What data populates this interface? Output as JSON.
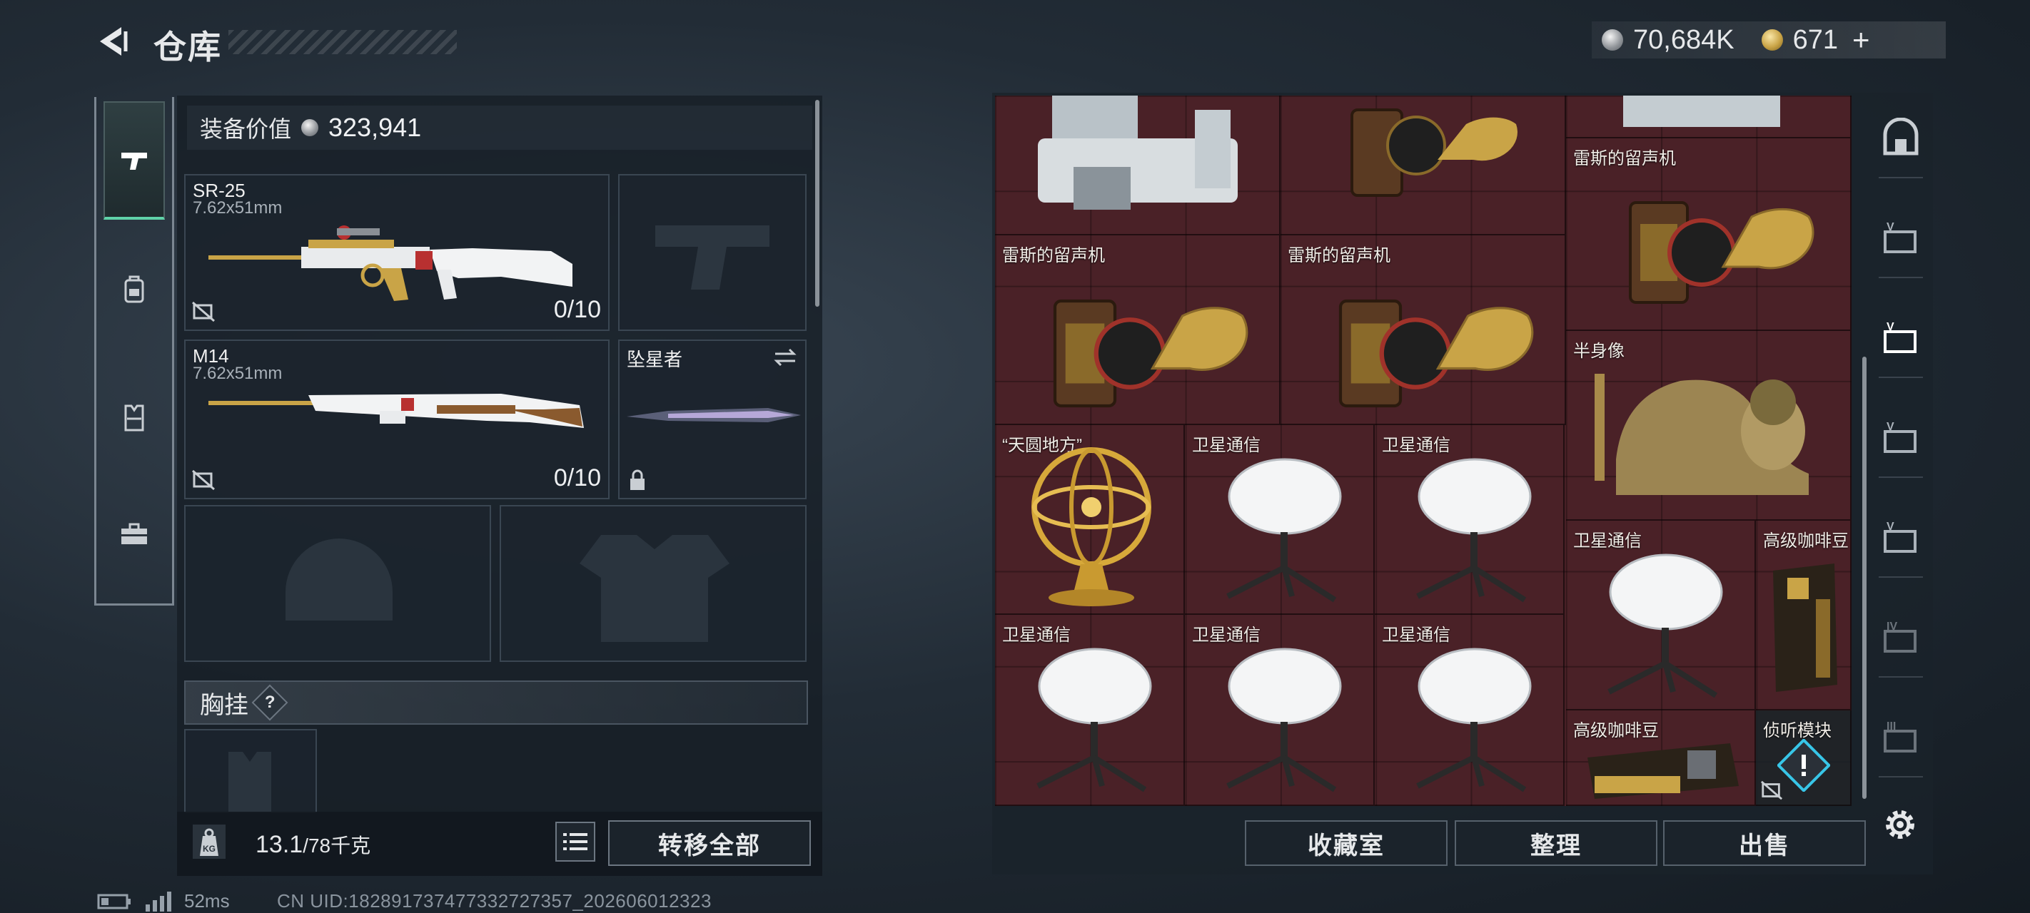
{
  "header": {
    "title": "仓库",
    "currency_silver": "70,684K",
    "currency_gold": "671",
    "plus": "+"
  },
  "left_tabs": [
    {
      "icon": "pistol-icon",
      "active": true
    },
    {
      "icon": "backpack-icon",
      "active": false
    },
    {
      "icon": "vest-icon",
      "active": false
    },
    {
      "icon": "toolbox-icon",
      "active": false
    }
  ],
  "equipment": {
    "value_label": "装备价值",
    "value": "323,941",
    "primary_weapon": {
      "name": "SR-25",
      "caliber": "7.62x51mm",
      "ammo": "0/10"
    },
    "secondary_weapon": {
      "name": "M14",
      "caliber": "7.62x51mm",
      "ammo": "0/10"
    },
    "melee": {
      "name": "坠星者"
    },
    "chest_rig_label": "胸挂",
    "chest_rig_help": "?",
    "weight": "13.1",
    "weight_max": "/78千克",
    "transfer_all": "转移全部"
  },
  "storage": {
    "items": [
      {
        "label": "雷斯的留声机"
      },
      {
        "label": "雷斯的留声机"
      },
      {
        "label": "雷斯的留声机"
      },
      {
        "label": "半身像"
      },
      {
        "label": "“天圆地方”"
      },
      {
        "label": "卫星通信"
      },
      {
        "label": "卫星通信"
      },
      {
        "label": "卫星通信"
      },
      {
        "label": "高级咖啡豆"
      },
      {
        "label": "卫星通信"
      },
      {
        "label": "卫星通信"
      },
      {
        "label": "卫星通信"
      },
      {
        "label": "高级咖啡豆"
      },
      {
        "label": "侦听模块"
      }
    ],
    "buttons": {
      "collection": "收藏室",
      "organize": "整理",
      "sell": "出售"
    }
  },
  "right_tabs": [
    {
      "icon": "vault-icon",
      "label": ""
    },
    {
      "icon": "storage-tab-icon",
      "label": "V"
    },
    {
      "icon": "storage-tab-icon",
      "label": "V"
    },
    {
      "icon": "storage-tab-icon",
      "label": "V"
    },
    {
      "icon": "storage-tab-icon",
      "label": "V"
    },
    {
      "icon": "storage-tab-icon",
      "label": "IV"
    },
    {
      "icon": "storage-tab-icon",
      "label": "III"
    }
  ],
  "status": {
    "ping": "52ms",
    "uid": "CN UID:182891737477332727357_202606012323"
  },
  "colors": {
    "accent_green": "#5fd2a8",
    "storage_bg": "#4a2127"
  }
}
